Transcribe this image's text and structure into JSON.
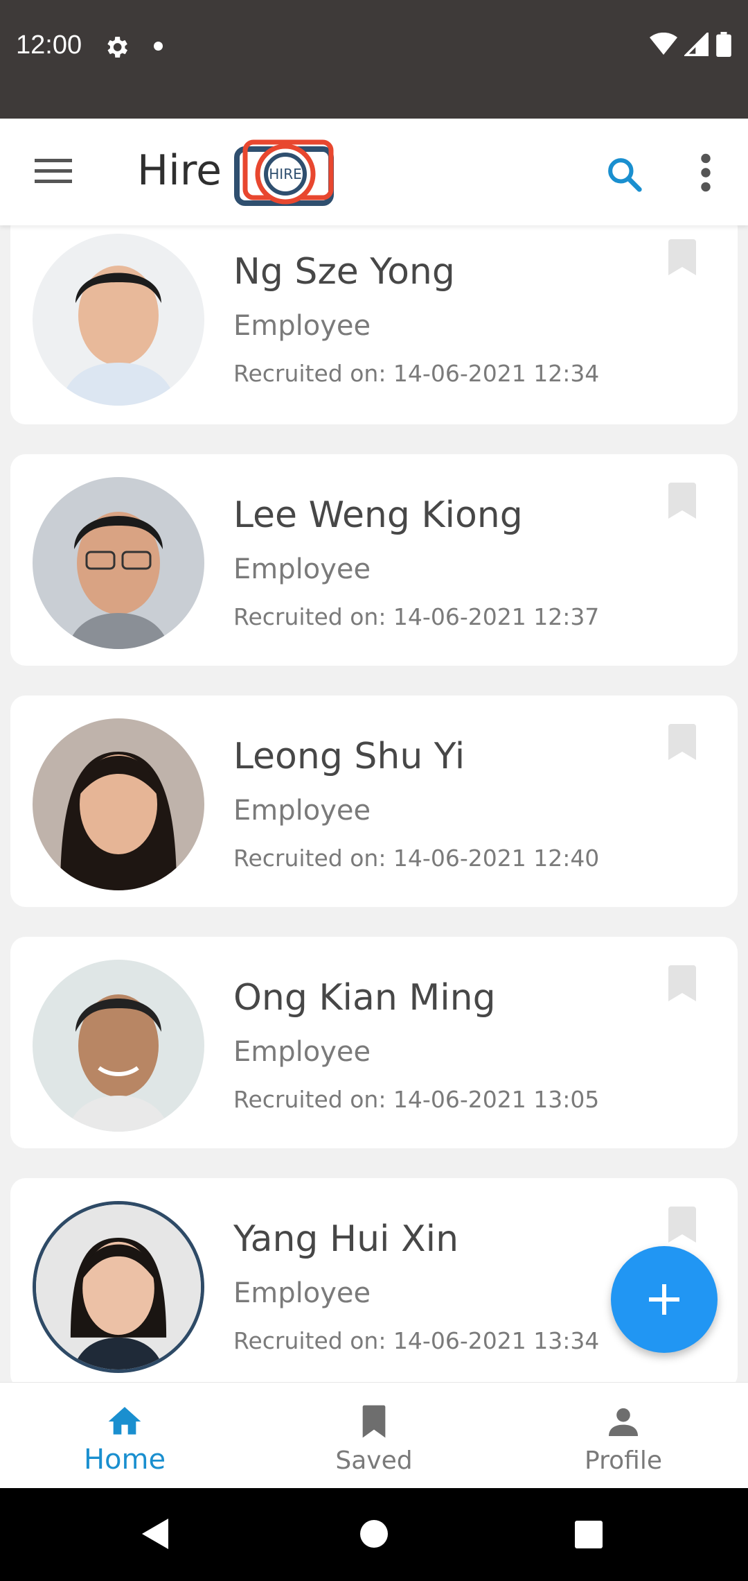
{
  "status_bar": {
    "time": "12:00"
  },
  "app_bar": {
    "title": "Hire",
    "logo_text": "HIRE"
  },
  "colors": {
    "accent": "#1a8fcf",
    "fab": "#2196f3",
    "status_bg": "#3e3a39"
  },
  "employees": [
    {
      "name": "Ng Sze Yong",
      "role": "Employee",
      "recruited": "Recruited on: 14-06-2021 12:34"
    },
    {
      "name": "Lee Weng Kiong",
      "role": "Employee",
      "recruited": "Recruited on: 14-06-2021 12:37"
    },
    {
      "name": "Leong Shu Yi",
      "role": "Employee",
      "recruited": "Recruited on: 14-06-2021 12:40"
    },
    {
      "name": "Ong Kian Ming",
      "role": "Employee",
      "recruited": "Recruited on: 14-06-2021 13:05"
    },
    {
      "name": "Yang Hui Xin",
      "role": "Employee",
      "recruited": "Recruited on: 14-06-2021 13:34"
    }
  ],
  "fab": {
    "icon": "plus-icon"
  },
  "bottom_nav": [
    {
      "label": "Home",
      "icon": "home-icon",
      "active": true
    },
    {
      "label": "Saved",
      "icon": "bookmark-icon",
      "active": false
    },
    {
      "label": "Profile",
      "icon": "person-icon",
      "active": false
    }
  ]
}
